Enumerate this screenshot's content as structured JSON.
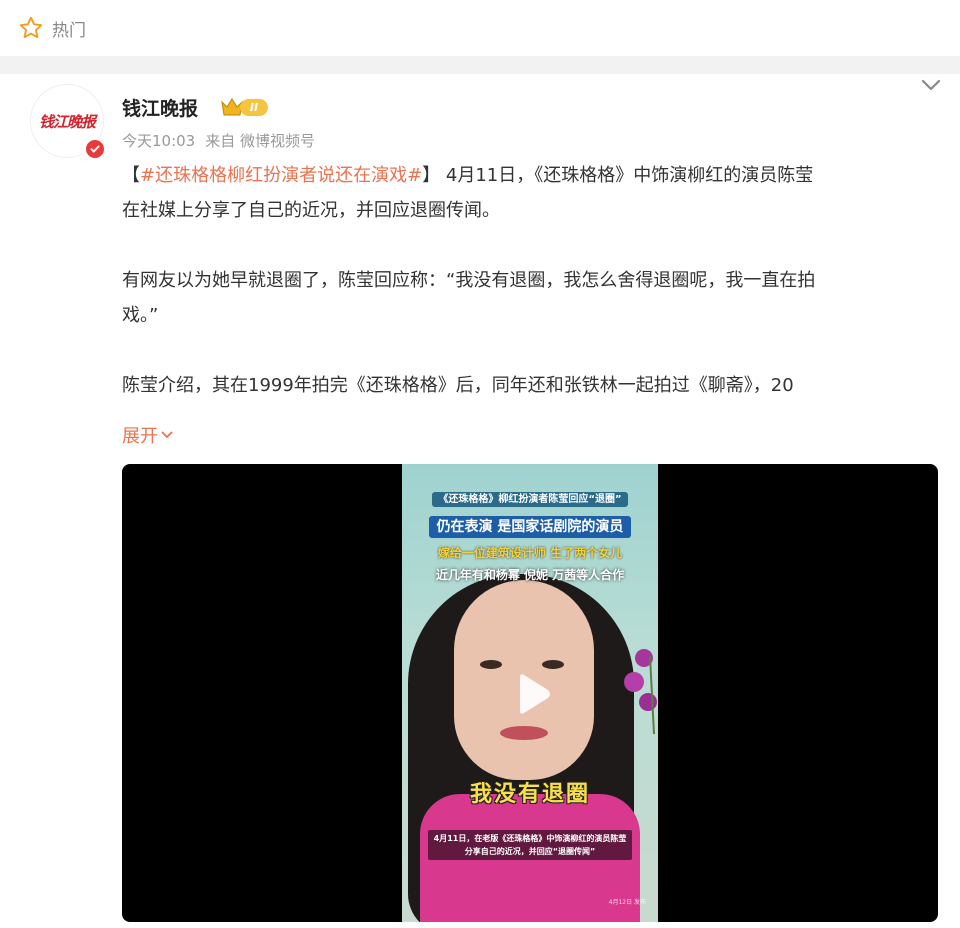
{
  "hot": {
    "label": "热门"
  },
  "user": {
    "name": "钱江晚报",
    "logo_text": "钱江晚报",
    "vip_level": "II"
  },
  "meta": {
    "time": "今天10:03",
    "source_prefix": "来自",
    "source": "微博视频号"
  },
  "post": {
    "bracket_open": "【",
    "hashtag": "#还珠格格柳红扮演者说还在演戏#",
    "bracket_close": "】",
    "p1_rest": "4月11日，《还珠格格》中饰演柳红的演员陈莹",
    "p1_line2": "在社媒上分享了自己的近况，并回应退圈传闻。",
    "p2_line1": "有网友以为她早就退圈了，陈莹回应称：“我没有退圈，我怎么舍得退圈呢，我一直在拍",
    "p2_line2": "戏。”",
    "p3_line1": "陈莹介绍，其在1999年拍完《还珠格格》后，同年还和张铁林一起拍过《聊斋》，20",
    "expand": "展开"
  },
  "video": {
    "caption_top": "《还珠格格》柳红扮演者陈莹回应“退圈”",
    "caption_blue": "仍在表演 是国家话剧院的演员",
    "caption_yellow": "嫁给一位建筑设计师 生了两个女儿",
    "caption_white": "近几年有和杨幂 倪妮 万茜等人合作",
    "subtitle": "我没有退圈",
    "caption_bottom_1": "4月11日，在老版《还珠格格》中饰演柳红的演员陈莹",
    "caption_bottom_2": "分享自己的近况，并回应“退圈传闻”",
    "date_mark": "4月12日 发布"
  },
  "colors": {
    "accent": "#eb7350",
    "verified": "#e83a3a",
    "vip": "#f5c542"
  }
}
